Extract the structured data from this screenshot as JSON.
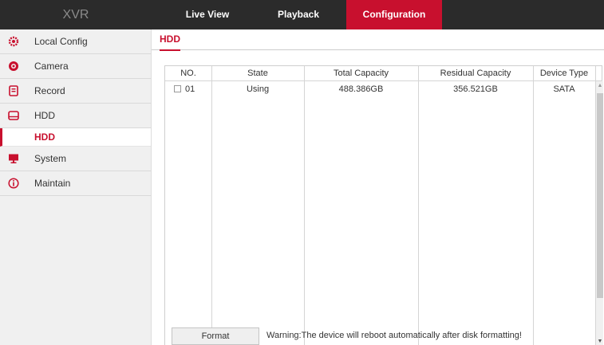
{
  "app": {
    "brand": "XVR"
  },
  "nav": {
    "live_view": "Live View",
    "playback": "Playback",
    "configuration": "Configuration"
  },
  "sidebar": {
    "items": [
      {
        "label": "Local Config",
        "icon": "gear-icon"
      },
      {
        "label": "Camera",
        "icon": "camera-icon"
      },
      {
        "label": "Record",
        "icon": "record-icon"
      },
      {
        "label": "HDD",
        "icon": "hdd-icon"
      },
      {
        "label": "System",
        "icon": "monitor-icon"
      },
      {
        "label": "Maintain",
        "icon": "info-icon"
      }
    ],
    "sub_item": "HDD"
  },
  "main": {
    "tab": "HDD",
    "table": {
      "headers": [
        "NO.",
        "State",
        "Total Capacity",
        "Residual Capacity",
        "Device Type"
      ],
      "rows": [
        {
          "no": "01",
          "state": "Using",
          "total": "488.386GB",
          "residual": "356.521GB",
          "type": "SATA"
        }
      ]
    },
    "format_button": "Format",
    "warning": "Warning:The device will reboot automatically after disk formatting!"
  },
  "colors": {
    "accent": "#c8102e",
    "topbar": "#2b2b2b",
    "sidebar": "#f0f0f0"
  }
}
